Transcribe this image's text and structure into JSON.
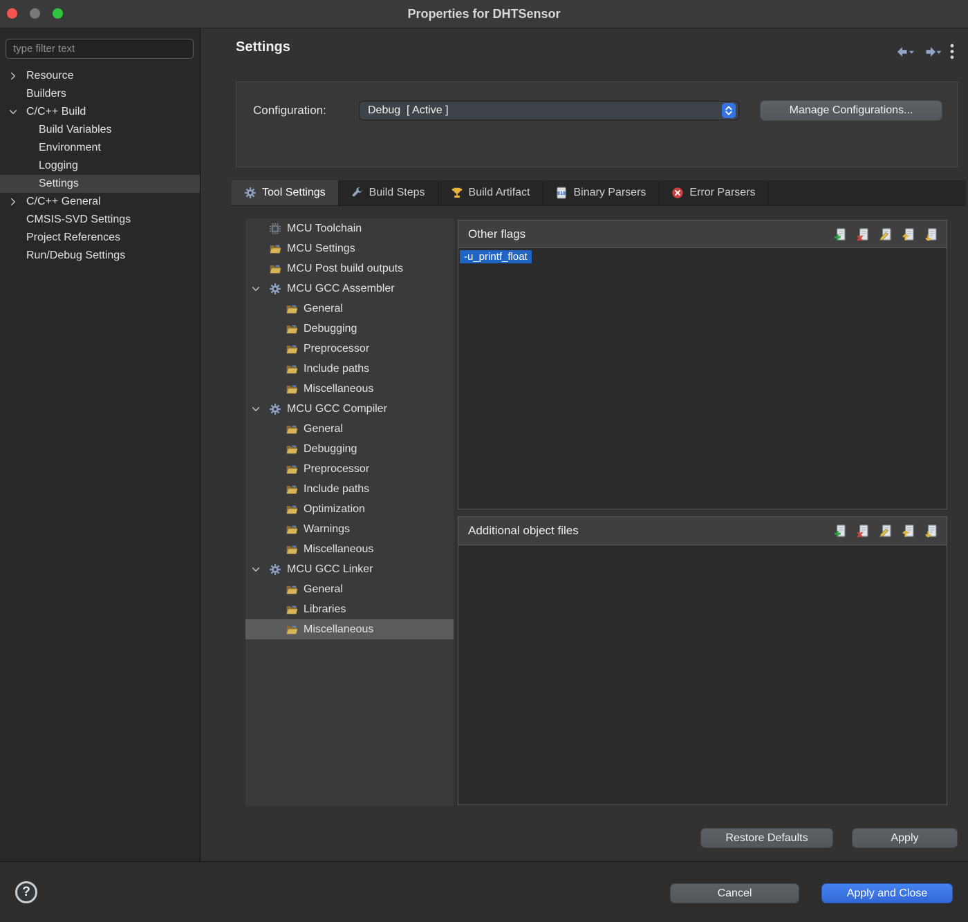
{
  "window": {
    "title": "Properties for DHTSensor"
  },
  "sidebar": {
    "filter_placeholder": "type filter text",
    "tree": [
      {
        "label": "Resource",
        "level": 0,
        "chevron": "collapsed"
      },
      {
        "label": "Builders",
        "level": 0
      },
      {
        "label": "C/C++ Build",
        "level": 0,
        "chevron": "expanded"
      },
      {
        "label": "Build Variables",
        "level": 1
      },
      {
        "label": "Environment",
        "level": 1
      },
      {
        "label": "Logging",
        "level": 1
      },
      {
        "label": "Settings",
        "level": 1,
        "selected": true
      },
      {
        "label": "C/C++ General",
        "level": 0,
        "chevron": "collapsed"
      },
      {
        "label": "CMSIS-SVD Settings",
        "level": 0
      },
      {
        "label": "Project References",
        "level": 0
      },
      {
        "label": "Run/Debug Settings",
        "level": 0
      }
    ]
  },
  "header": {
    "title": "Settings"
  },
  "configuration": {
    "label": "Configuration:",
    "selected": "Debug  [ Active ]",
    "manage_button": "Manage Configurations..."
  },
  "tabs": [
    {
      "label": "Tool Settings",
      "icon": "gear-icon",
      "active": true
    },
    {
      "label": "Build Steps",
      "icon": "wrench-icon",
      "active": false
    },
    {
      "label": "Build Artifact",
      "icon": "trophy-icon",
      "active": false
    },
    {
      "label": "Binary Parsers",
      "icon": "binary-file-icon",
      "active": false
    },
    {
      "label": "Error Parsers",
      "icon": "error-icon",
      "active": false
    }
  ],
  "tool_tree": [
    {
      "label": "MCU Toolchain",
      "icon": "chip-icon",
      "level": 0
    },
    {
      "label": "MCU Settings",
      "icon": "folder-icon",
      "level": 0
    },
    {
      "label": "MCU Post build outputs",
      "icon": "folder-icon",
      "level": 0
    },
    {
      "label": "MCU GCC Assembler",
      "icon": "gears-icon",
      "level": 0,
      "chevron": "expanded"
    },
    {
      "label": "General",
      "icon": "folder-icon",
      "level": 1
    },
    {
      "label": "Debugging",
      "icon": "folder-icon",
      "level": 1
    },
    {
      "label": "Preprocessor",
      "icon": "folder-icon",
      "level": 1
    },
    {
      "label": "Include paths",
      "icon": "folder-icon",
      "level": 1
    },
    {
      "label": "Miscellaneous",
      "icon": "folder-icon",
      "level": 1
    },
    {
      "label": "MCU GCC Compiler",
      "icon": "gears-icon",
      "level": 0,
      "chevron": "expanded"
    },
    {
      "label": "General",
      "icon": "folder-icon",
      "level": 1
    },
    {
      "label": "Debugging",
      "icon": "folder-icon",
      "level": 1
    },
    {
      "label": "Preprocessor",
      "icon": "folder-icon",
      "level": 1
    },
    {
      "label": "Include paths",
      "icon": "folder-icon",
      "level": 1
    },
    {
      "label": "Optimization",
      "icon": "folder-icon",
      "level": 1
    },
    {
      "label": "Warnings",
      "icon": "folder-icon",
      "level": 1
    },
    {
      "label": "Miscellaneous",
      "icon": "folder-icon",
      "level": 1
    },
    {
      "label": "MCU GCC Linker",
      "icon": "gears-icon",
      "level": 0,
      "chevron": "expanded"
    },
    {
      "label": "General",
      "icon": "folder-icon",
      "level": 1
    },
    {
      "label": "Libraries",
      "icon": "folder-icon",
      "level": 1
    },
    {
      "label": "Miscellaneous",
      "icon": "folder-icon",
      "level": 1,
      "selected": true
    }
  ],
  "lists": [
    {
      "title": "Other flags",
      "toolbar": [
        "add",
        "delete",
        "edit",
        "move-up",
        "move-down"
      ],
      "items": [
        {
          "text": "-u_printf_float",
          "selected": true
        }
      ]
    },
    {
      "title": "Additional object files",
      "toolbar": [
        "add",
        "delete",
        "edit",
        "move-up",
        "move-down"
      ],
      "items": []
    }
  ],
  "footer": {
    "restore_defaults": "Restore Defaults",
    "apply": "Apply",
    "cancel": "Cancel",
    "apply_and_close": "Apply and Close",
    "help_glyph": "?"
  },
  "icons_used": [
    "back-icon",
    "forward-icon",
    "kebab-menu-icon",
    "folder-icon",
    "gears-icon",
    "chip-icon",
    "gear-icon",
    "wrench-icon",
    "trophy-icon",
    "binary-file-icon",
    "error-icon",
    "add-icon",
    "delete-icon",
    "edit-icon",
    "move-up-icon",
    "move-down-icon",
    "question-mark-icon"
  ],
  "colors": {
    "accent_blue": "#3b7ae8",
    "selection_blue": "#2065c4",
    "panel_dark": "#2b2b2b",
    "panel_mid": "#3a3a3a"
  }
}
